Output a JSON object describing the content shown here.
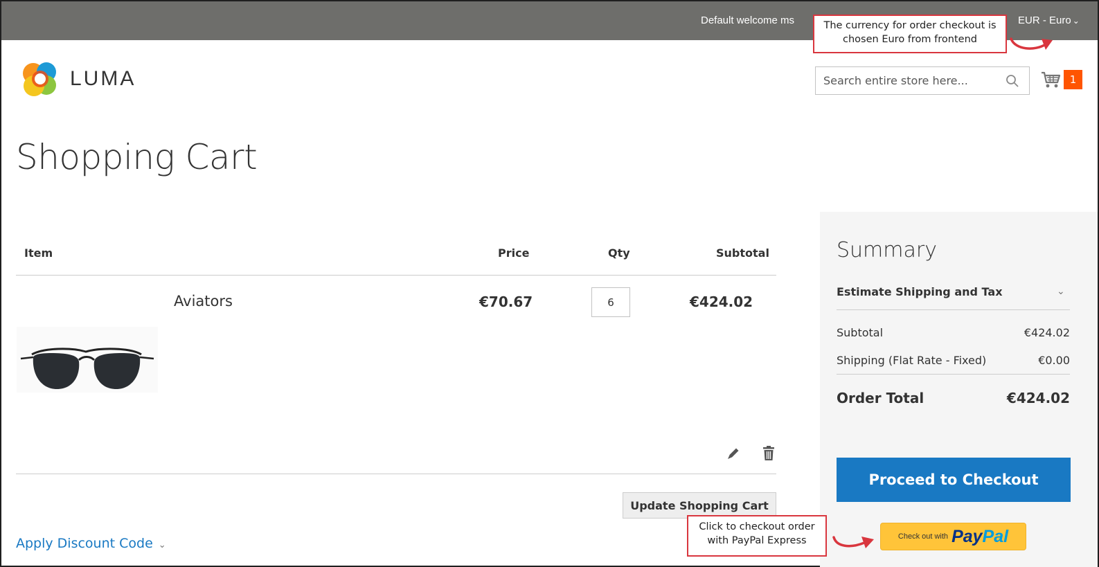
{
  "header": {
    "welcome_text": "Default welcome ms",
    "currency_label": "EUR - Euro",
    "logo_text": "LUMA"
  },
  "annotations": {
    "currency_note": "The currency for order checkout is chosen Euro from frontend",
    "paypal_note": "Click to checkout order with PayPal Express"
  },
  "search": {
    "placeholder": "Search entire store here..."
  },
  "minicart": {
    "count": "1"
  },
  "page": {
    "title": "Shopping Cart"
  },
  "cart": {
    "columns": {
      "item": "Item",
      "price": "Price",
      "qty": "Qty",
      "subtotal": "Subtotal"
    },
    "items": [
      {
        "name": "Aviators",
        "price": "€70.67",
        "qty": "6",
        "subtotal": "€424.02"
      }
    ],
    "update_button": "Update Shopping Cart",
    "discount_link": "Apply Discount Code"
  },
  "summary": {
    "title": "Summary",
    "estimate_label": "Estimate Shipping and Tax",
    "subtotal_label": "Subtotal",
    "subtotal_value": "€424.02",
    "shipping_label": "Shipping (Flat Rate - Fixed)",
    "shipping_value": "€0.00",
    "order_total_label": "Order Total",
    "order_total_value": "€424.02",
    "checkout_button": "Proceed to Checkout",
    "paypal_small": "Check out with",
    "paypal_pay": "Pay",
    "paypal_pal": "Pal"
  },
  "colors": {
    "topbar": "#6e6e6b",
    "accent_blue": "#1979c3",
    "cart_badge": "#ff5501",
    "paypal_yellow": "#ffc439",
    "annotation_red": "#d9363e"
  },
  "icons": [
    "search-icon",
    "cart-icon",
    "edit-icon",
    "trash-icon",
    "chevron-down-icon"
  ]
}
